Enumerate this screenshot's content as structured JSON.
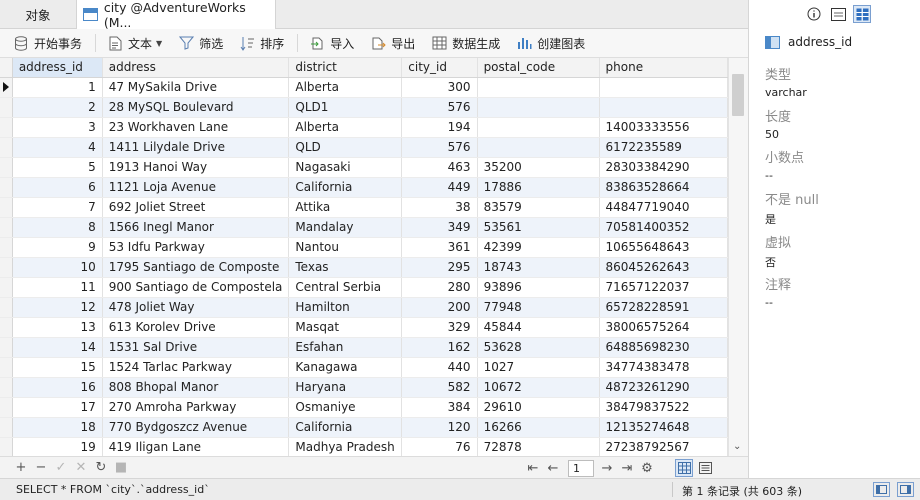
{
  "tabs": {
    "objects": "对象",
    "active": "city @AdventureWorks (M..."
  },
  "toolbar": {
    "begin_transaction": "开始事务",
    "text": "文本",
    "filter": "筛选",
    "sort": "排序",
    "import": "导入",
    "export": "导出",
    "generate_data": "数据生成",
    "create_chart": "创建图表"
  },
  "grid": {
    "columns": [
      "address_id",
      "address",
      "district",
      "city_id",
      "postal_code",
      "phone"
    ],
    "rows": [
      [
        "1",
        "47 MySakila Drive",
        "Alberta",
        "300",
        "",
        ""
      ],
      [
        "2",
        "28 MySQL Boulevard",
        "QLD1",
        "576",
        "",
        ""
      ],
      [
        "3",
        "23 Workhaven Lane",
        "Alberta",
        "194",
        "",
        "14003333556"
      ],
      [
        "4",
        "1411 Lilydale Drive",
        "QLD",
        "576",
        "",
        "6172235589"
      ],
      [
        "5",
        "1913 Hanoi Way",
        "Nagasaki",
        "463",
        "35200",
        "28303384290"
      ],
      [
        "6",
        "1121 Loja Avenue",
        "California",
        "449",
        "17886",
        "83863528664"
      ],
      [
        "7",
        "692 Joliet Street",
        "Attika",
        "38",
        "83579",
        "44847719040"
      ],
      [
        "8",
        "1566 Inegl Manor",
        "Mandalay",
        "349",
        "53561",
        "70581400352"
      ],
      [
        "9",
        "53 Idfu Parkway",
        "Nantou",
        "361",
        "42399",
        "10655648643"
      ],
      [
        "10",
        "1795 Santiago de Composte",
        "Texas",
        "295",
        "18743",
        "86045262643"
      ],
      [
        "11",
        "900 Santiago de Compostela",
        "Central Serbia",
        "280",
        "93896",
        "71657122037"
      ],
      [
        "12",
        "478 Joliet Way",
        "Hamilton",
        "200",
        "77948",
        "65728228591"
      ],
      [
        "13",
        "613 Korolev Drive",
        "Masqat",
        "329",
        "45844",
        "38006575264"
      ],
      [
        "14",
        "1531 Sal Drive",
        "Esfahan",
        "162",
        "53628",
        "64885698230"
      ],
      [
        "15",
        "1524 Tarlac Parkway",
        "Kanagawa",
        "440",
        "1027",
        "34774383478"
      ],
      [
        "16",
        "808 Bhopal Manor",
        "Haryana",
        "582",
        "10672",
        "48723261290"
      ],
      [
        "17",
        "270 Amroha Parkway",
        "Osmaniye",
        "384",
        "29610",
        "38479837522"
      ],
      [
        "18",
        "770 Bydgoszcz Avenue",
        "California",
        "120",
        "16266",
        "12135274648"
      ],
      [
        "19",
        "419 Iligan Lane",
        "Madhya Pradesh",
        "76",
        "72878",
        "27238792567"
      ]
    ]
  },
  "pager": {
    "page": "1"
  },
  "status": {
    "sql": "SELECT * FROM `city`.`address_id`",
    "records": "第 1 条记录 (共 603 条)"
  },
  "panel": {
    "field_name": "address_id",
    "props": [
      {
        "label": "类型",
        "value": "varchar"
      },
      {
        "label": "长度",
        "value": "50"
      },
      {
        "label": "小数点",
        "value": "--"
      },
      {
        "label": "不是 null",
        "value": "是"
      },
      {
        "label": "虚拟",
        "value": "否"
      },
      {
        "label": "注释",
        "value": "--"
      }
    ]
  },
  "colors": {
    "accent": "#4a88c8",
    "row_alt": "#eef3fa",
    "selected_header": "#dce8f6"
  }
}
